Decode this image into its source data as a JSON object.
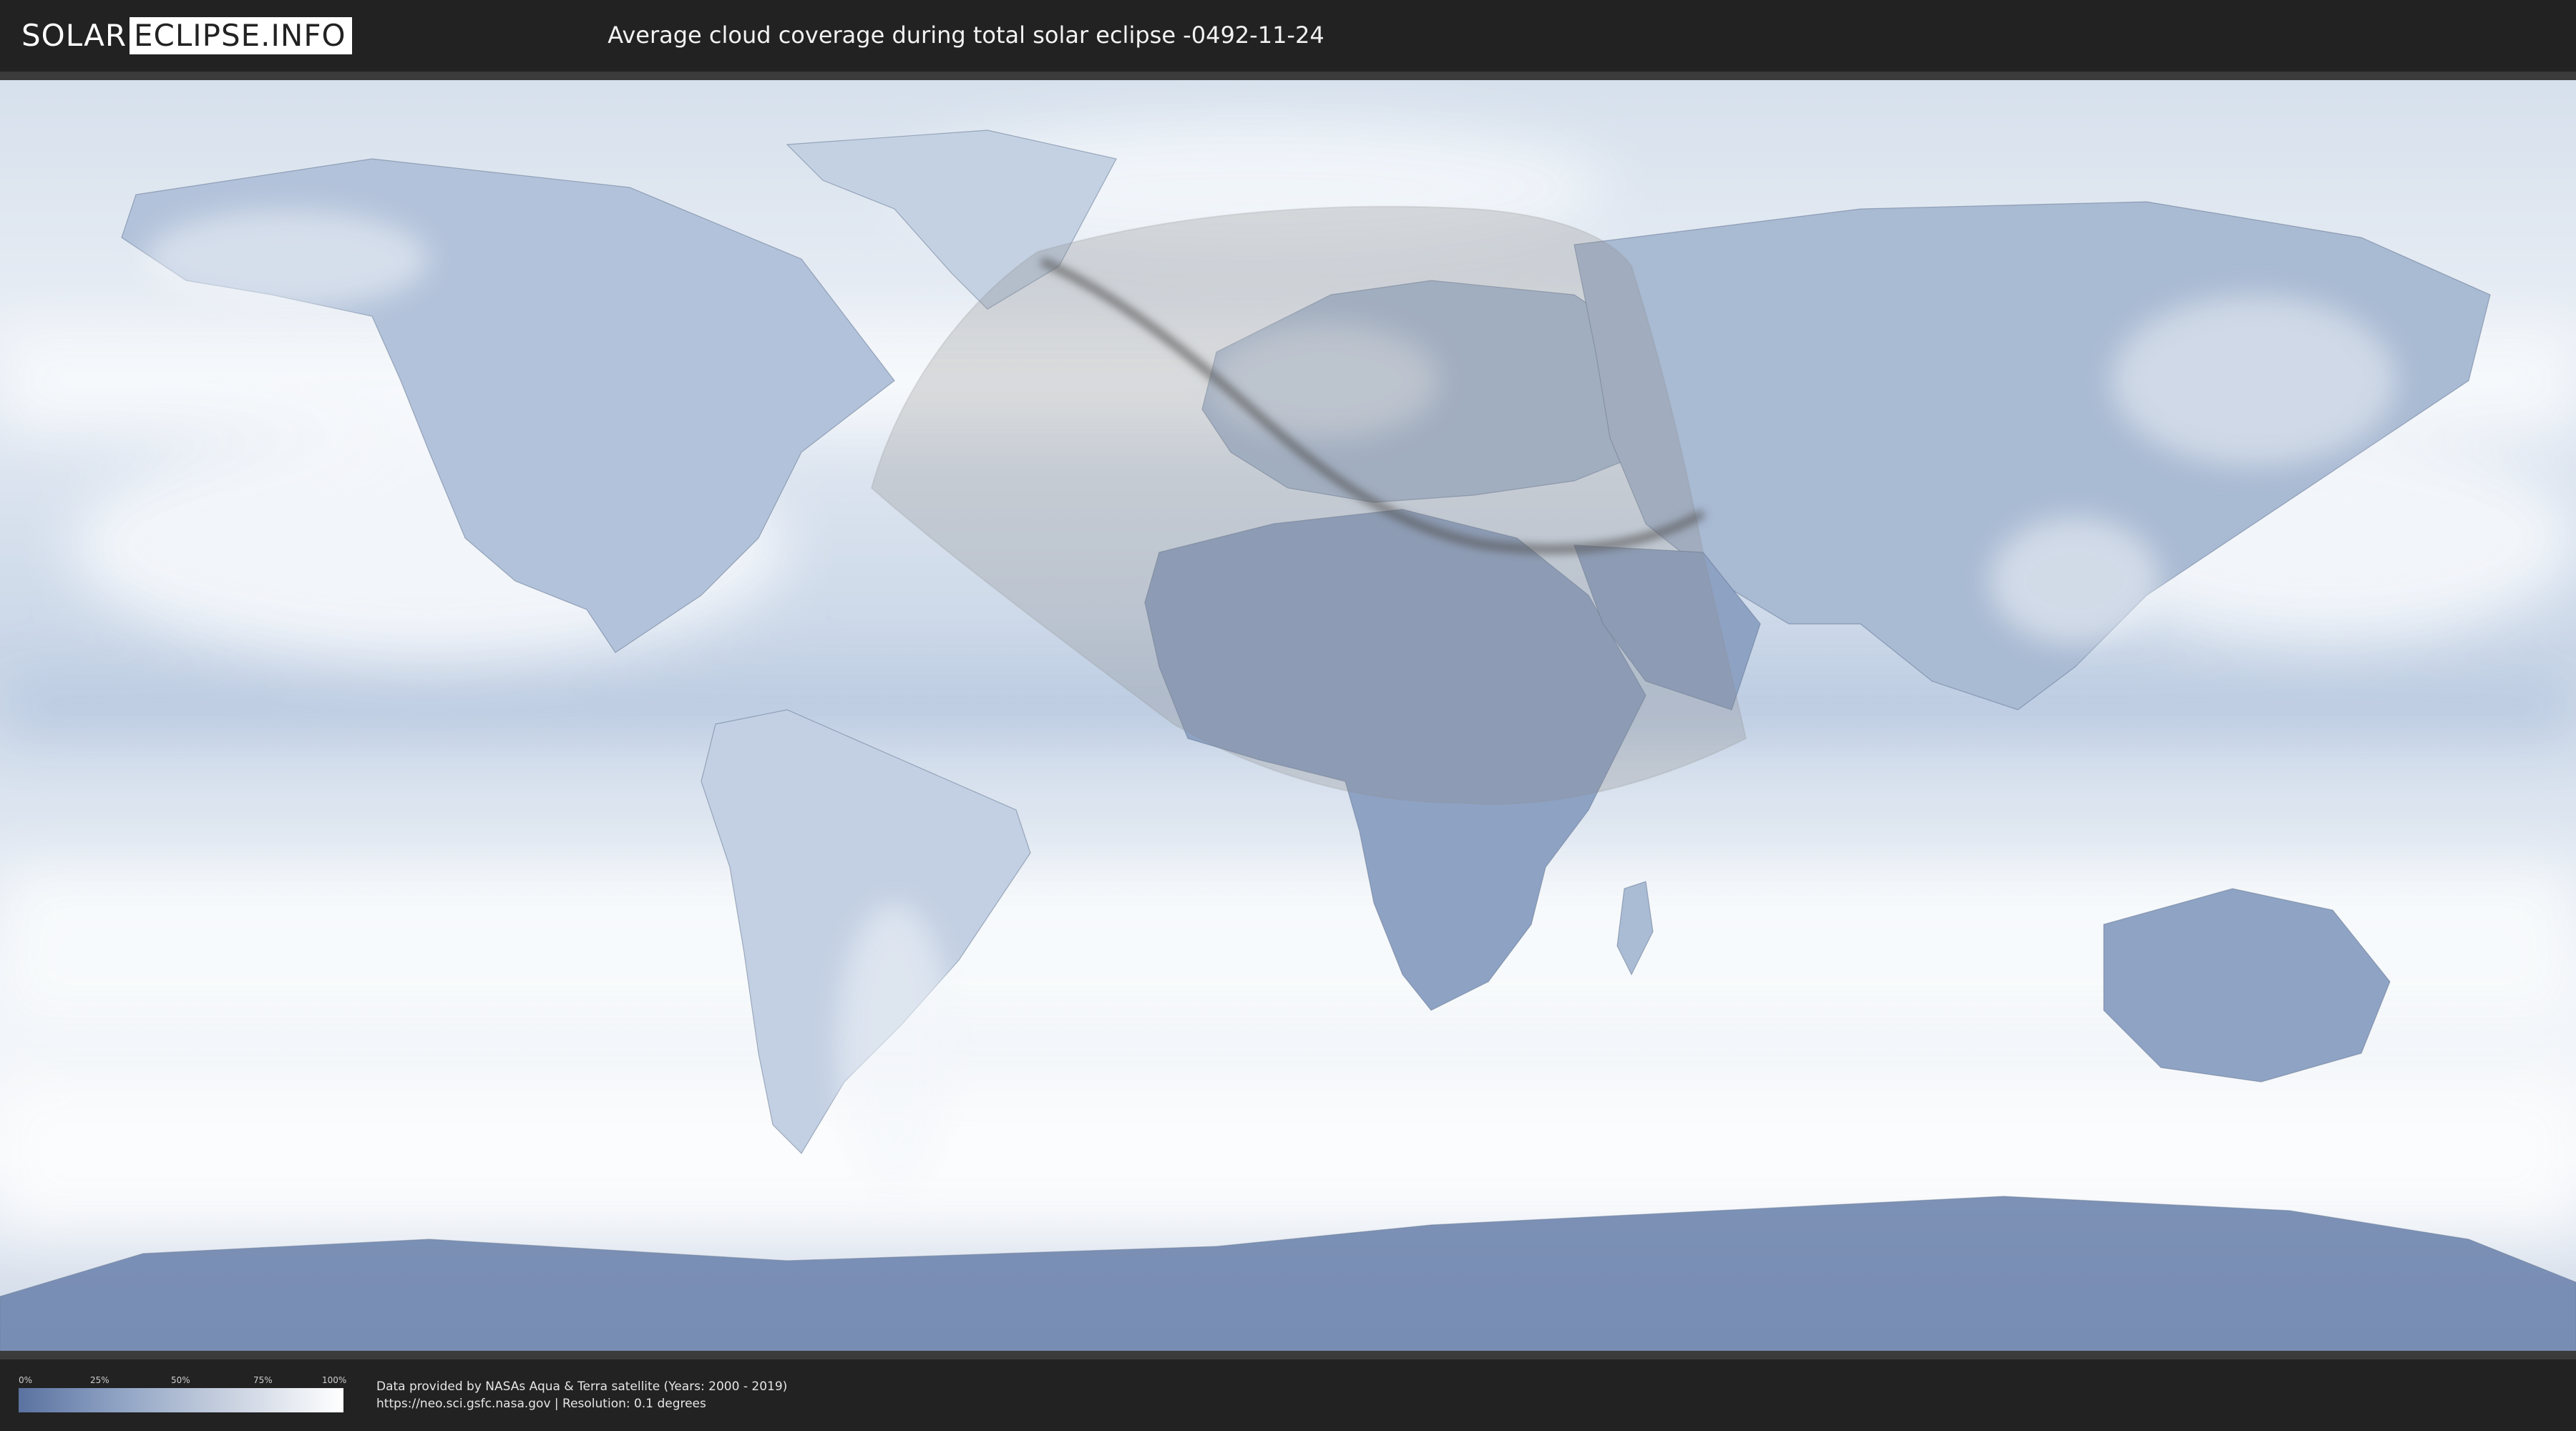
{
  "header": {
    "logo_solar": "SOLAR",
    "logo_eclipse": "ECLIPSE.INFO",
    "title": "Average cloud coverage during total solar eclipse -0492-11-24"
  },
  "legend": {
    "ticks": [
      "0%",
      "25%",
      "50%",
      "75%",
      "100%"
    ],
    "colors": {
      "min": "#5a72a0",
      "max": "#ffffff"
    }
  },
  "footer": {
    "attribution_line1": "Data provided by NASAs Aqua & Terra satellite (Years: 2000 - 2019)",
    "attribution_line2": "https://neo.sci.gsfc.nasa.gov | Resolution: 0.1 degrees"
  },
  "map": {
    "projection": "equirectangular",
    "ocean_color": "#dbe4ef",
    "cloud_color": "#f5f7fa",
    "land_clear_color": "#7e93b8",
    "shadow_color": "#8c8c8c",
    "path_color": "#555555"
  }
}
